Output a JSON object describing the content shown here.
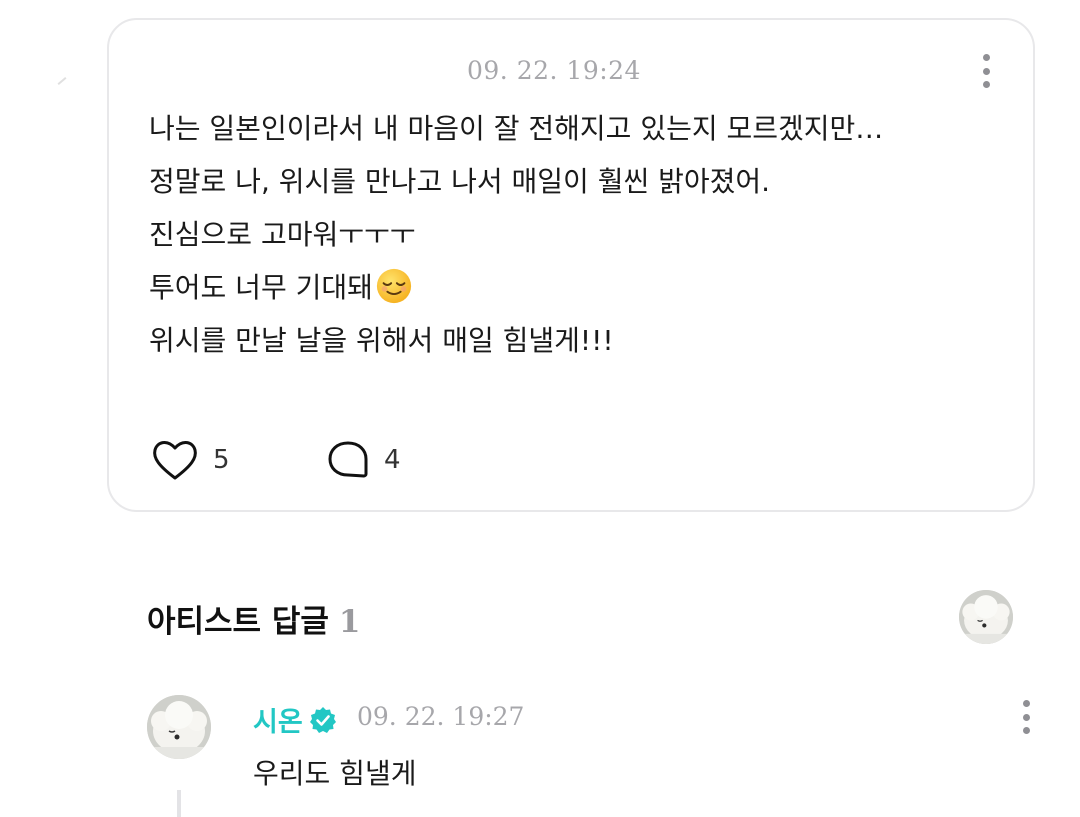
{
  "post": {
    "timestamp": "09. 22. 19:24",
    "lines": [
      "나는 일본인이라서 내 마음이 잘 전해지고 있는지 모르겠지만…",
      "정말로 나, 위시를 만나고 나서 매일이 훨씬 밝아졌어.",
      "진심으로 고마워ㅜㅜㅜ",
      "투어도 너무 기대돼",
      "위시를 만날 날을 위해서 매일 힘낼게!!!"
    ],
    "emoji_icon": "relieved-face-emoji",
    "likes": "5",
    "comments": "4"
  },
  "artist_replies": {
    "title": "아티스트 답글",
    "count": "1"
  },
  "reply": {
    "author": "시온",
    "verified_icon": "verified-badge-icon",
    "timestamp": "09. 22. 19:27",
    "text": "우리도 힘낼게"
  },
  "colors": {
    "accent": "#22c7c4",
    "muted_text": "#a7a7ab",
    "card_border": "#e8e8ea"
  }
}
